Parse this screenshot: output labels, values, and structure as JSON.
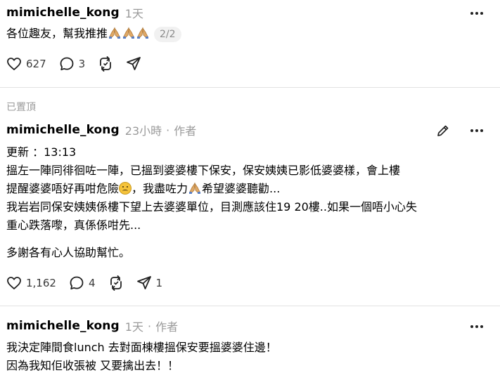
{
  "post1": {
    "username": "mimichelle_kong",
    "time": "1天",
    "text": "各位趣友，幫我推推",
    "badge": "2/2",
    "likes": "627",
    "comments": "3"
  },
  "pinned_label": "已置頂",
  "post2": {
    "username": "mimichelle_kong",
    "time": "23小時",
    "author": "作者",
    "lines": [
      "更新 ：13:13",
      "搵左一陣同徘徊咗一陣，",
      "已搵到婆婆樓下保安，保安姨姨已影低婆婆樣，會上樓",
      "提醒婆婆唔好再咁危險",
      "，我盡咗力",
      "希望婆婆聽勸...",
      "我岩岩同保安姨姨係樓下望上去婆婆單位，目測應該住19 20樓..如果一個唔小心失",
      "重心跌落嚟，真係係咁先...",
      "多謝各有心人協助幫忙。"
    ],
    "likes": "1,162",
    "comments": "4",
    "shares": "1"
  },
  "post3": {
    "username": "mimichelle_kong",
    "time": "1天",
    "author": "作者",
    "lines": [
      "我決定陣間食lunch 去對面棟樓搵保安要搵婆婆住邊！",
      "因為我知佢收張被 又要擒出去！！"
    ]
  },
  "icons": {
    "like": "heart-icon",
    "comment": "comment-icon",
    "repost": "repost-icon",
    "share": "share-icon",
    "more": "more-icon",
    "edit": "edit-icon",
    "pray": "folded-hands-emoji",
    "sad": "frowning-face-emoji"
  },
  "colors": {
    "muted": "#9a9a9a",
    "divider": "#e2e2e2",
    "text": "#000000"
  }
}
